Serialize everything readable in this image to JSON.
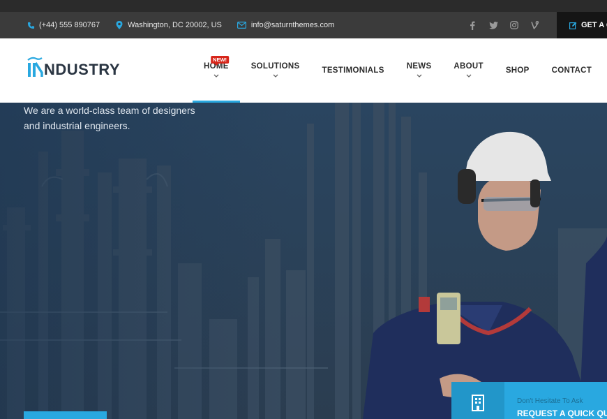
{
  "topbar": {
    "phone": "(+44) 555 890767",
    "address": "Washington, DC 20002, US",
    "email": "info@saturnthemes.com",
    "social": [
      "facebook-icon",
      "twitter-icon",
      "instagram-icon",
      "vine-icon"
    ],
    "quote_label": "GET A Q"
  },
  "logo": {
    "text": "NDUSTRY"
  },
  "nav": {
    "items": [
      {
        "label": "HOME",
        "badge": "NEW!",
        "active": true,
        "dropdown": true
      },
      {
        "label": "SOLUTIONS",
        "dropdown": true
      },
      {
        "label": "TESTIMONIALS",
        "dropdown": false
      },
      {
        "label": "NEWS",
        "dropdown": true
      },
      {
        "label": "ABOUT",
        "dropdown": true
      },
      {
        "label": "SHOP",
        "dropdown": false
      },
      {
        "label": "CONTACT",
        "dropdown": false
      }
    ]
  },
  "hero": {
    "line1": "We are a world-class team of designers",
    "line2": "and industrial engineers."
  },
  "quick_quote": {
    "subtitle": "Don't Hesitate To Ask",
    "title": "REQUEST A QUICK QU"
  },
  "colors": {
    "accent": "#29a8e0",
    "dark": "#3b3b3b",
    "badge": "#d7261a"
  }
}
